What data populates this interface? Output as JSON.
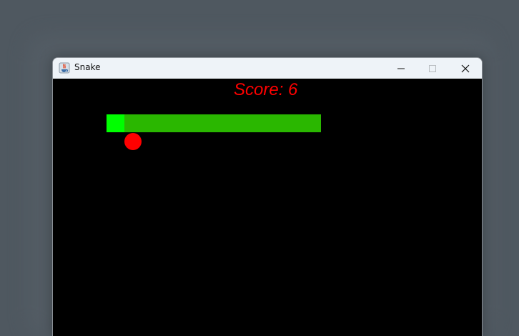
{
  "window": {
    "title": "Snake",
    "icon": "java-coffee-cup-icon"
  },
  "controls": {
    "minimize": "minimize-icon",
    "maximize": "maximize-icon",
    "close": "close-icon"
  },
  "game": {
    "score_label": "Score: ",
    "score": 6,
    "background_color": "#000000",
    "score_color": "#ff0000",
    "snake_head_color": "#00ff00",
    "snake_body_color": "#2ab700",
    "food_color": "#ff0000"
  }
}
